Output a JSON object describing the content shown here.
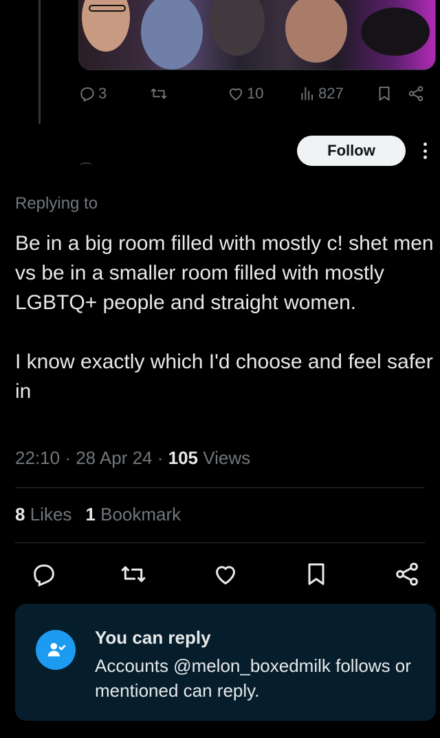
{
  "parent_tweet": {
    "reply_count": "3",
    "like_count": "10",
    "view_count": "827"
  },
  "follow_button": "Follow",
  "replying_to": "Replying to",
  "tweet": {
    "paragraph1": "Be in a big room filled with mostly c! shet men vs be in a smaller room filled with mostly LGBTQ+ people and straight women.",
    "paragraph2": "I know exactly which I'd choose and feel safer in",
    "time": "22:10",
    "date": "28 Apr 24",
    "views_count": "105",
    "views_label": "Views",
    "likes_count": "8",
    "likes_label": "Likes",
    "bookmarks_count": "1",
    "bookmarks_label": "Bookmark"
  },
  "reply_info": {
    "title": "You can reply",
    "body": "Accounts @melon_boxedmilk follows or mentioned can reply."
  },
  "colors": {
    "background": "#000000",
    "text": "#e7e9ea",
    "muted": "#71767b",
    "accent": "#1d9bf0",
    "card": "#061d2c"
  },
  "icons": [
    "reply-icon",
    "retweet-icon",
    "like-icon",
    "views-icon",
    "bookmark-icon",
    "share-icon",
    "more-icon",
    "user-check-icon"
  ]
}
